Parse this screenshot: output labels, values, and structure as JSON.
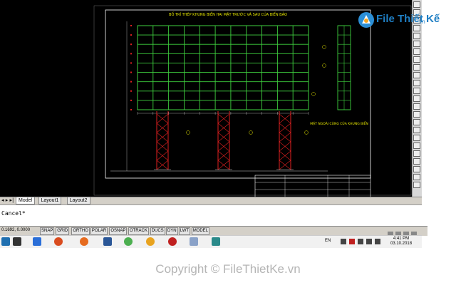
{
  "drawing": {
    "title": "BỐ TRÍ THÉP KHUNG BIỂN HAI MẶT TRƯỚC VÀ SAU CỦA BIỂN BẢO",
    "side_title": "MẶT NGOÀI CÙNG CỦA KHUNG BIỂN"
  },
  "logo": {
    "brand": "File Thiết Kế",
    "domain": ".vn"
  },
  "layout_tabs": [
    {
      "label": "Model",
      "active": true
    },
    {
      "label": "Layout1",
      "active": false
    },
    {
      "label": "Layout2",
      "active": false
    }
  ],
  "command": {
    "text": "Cancel*"
  },
  "status": {
    "coords": "0.1692, 0.0000",
    "buttons": [
      "SNAP",
      "GRID",
      "ORTHO",
      "POLAR",
      "OSNAP",
      "OTRACK",
      "DUCS",
      "DYN",
      "LWT",
      "MODEL"
    ]
  },
  "taskbar": {
    "lang": "EN",
    "time": "4:41 PM",
    "date": "03.10.2018"
  },
  "footer": {
    "copyright": "Copyright © FileThietKe.vn"
  },
  "colors": {
    "grid": "#3fd13f",
    "frame": "#e02020",
    "text": "#e8e800",
    "border": "#ffffff"
  }
}
